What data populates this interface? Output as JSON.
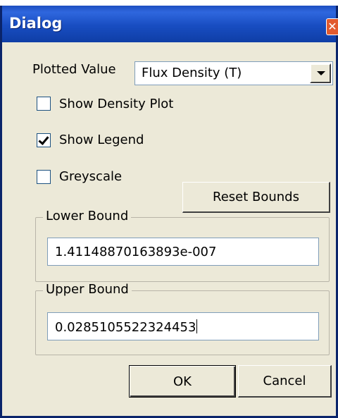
{
  "window": {
    "title": "Dialog"
  },
  "plotted_value": {
    "label": "Plotted Value",
    "selected": "Flux Density (T)"
  },
  "checkboxes": {
    "show_density_plot": {
      "label": "Show Density Plot",
      "checked": false
    },
    "show_legend": {
      "label": "Show Legend",
      "checked": true
    },
    "greyscale": {
      "label": "Greyscale",
      "checked": false
    }
  },
  "buttons": {
    "reset_bounds": "Reset Bounds",
    "ok": "OK",
    "cancel": "Cancel"
  },
  "lower_bound": {
    "label": "Lower Bound",
    "value": "1.41148870163893e-007"
  },
  "upper_bound": {
    "label": "Upper Bound",
    "value": "0.0285105522324453"
  },
  "icons": {
    "close": "close-icon",
    "dropdown": "chevron-down-icon",
    "check": "checkmark-icon"
  },
  "colors": {
    "titlebar": "#1d4fc0",
    "close_button": "#e25a2e",
    "dialog_background": "#ece9d8"
  }
}
